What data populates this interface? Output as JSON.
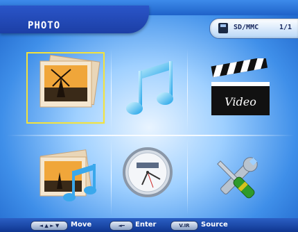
{
  "header": {
    "title": "PHOTO",
    "source_label": "SD/MMC",
    "page_indicator": "1/1"
  },
  "menu": {
    "items": [
      {
        "id": "photo",
        "icon": "photo-icon",
        "selected": true
      },
      {
        "id": "music",
        "icon": "music-note-icon",
        "selected": false
      },
      {
        "id": "video",
        "icon": "clapperboard-icon",
        "label": "Video",
        "selected": false
      },
      {
        "id": "photo-music",
        "icon": "photo-music-icon",
        "selected": false
      },
      {
        "id": "clock",
        "icon": "clock-icon",
        "selected": false
      },
      {
        "id": "settings",
        "icon": "tools-icon",
        "selected": false
      }
    ]
  },
  "footer": {
    "hints": [
      {
        "key": "◄ ▲ ► ▼",
        "label": "Move"
      },
      {
        "key": "◄━",
        "label": "Enter"
      },
      {
        "key": "V.IR",
        "label": "Source"
      }
    ]
  },
  "colors": {
    "selection": "#f4e23a",
    "background": "#1d6fd8"
  }
}
